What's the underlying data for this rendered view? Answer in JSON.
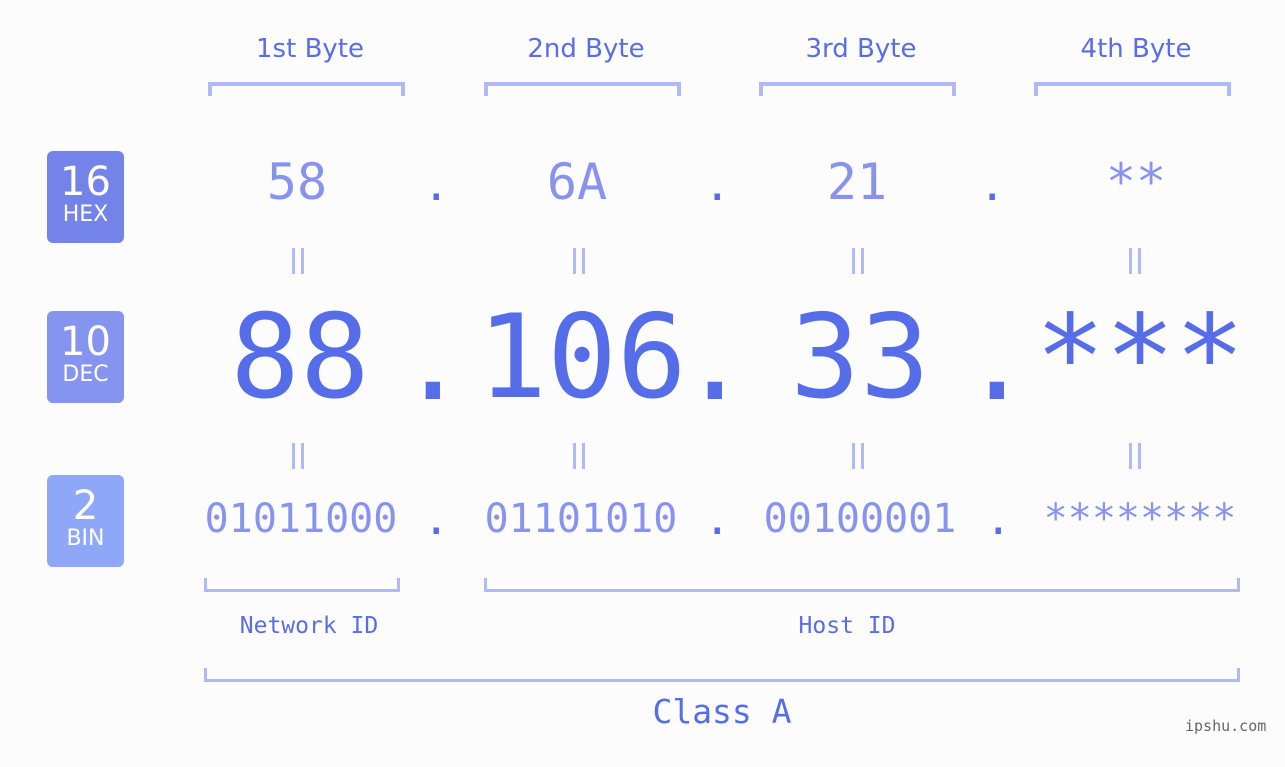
{
  "bytes": [
    {
      "label": "1st Byte",
      "hex": "58",
      "dec": "88",
      "bin": "01011000"
    },
    {
      "label": "2nd Byte",
      "hex": "6A",
      "dec": "106",
      "bin": "01101010"
    },
    {
      "label": "3rd Byte",
      "hex": "21",
      "dec": "33",
      "bin": "00100001"
    },
    {
      "label": "4th Byte",
      "hex": "**",
      "dec": "***",
      "bin": "********"
    }
  ],
  "separator": ".",
  "badges": [
    {
      "number": "16",
      "name": "HEX",
      "color": "#7483ea"
    },
    {
      "number": "10",
      "name": "DEC",
      "color": "#8595ef"
    },
    {
      "number": "2",
      "name": "BIN",
      "color": "#8fa7f9"
    }
  ],
  "network_id_label": "Network ID",
  "host_id_label": "Host ID",
  "class_label": "Class A",
  "watermark": "ipshu.com",
  "colors": {
    "accent": "#566de9",
    "light": "#8793ee",
    "bracket": "#b0b9f8"
  }
}
